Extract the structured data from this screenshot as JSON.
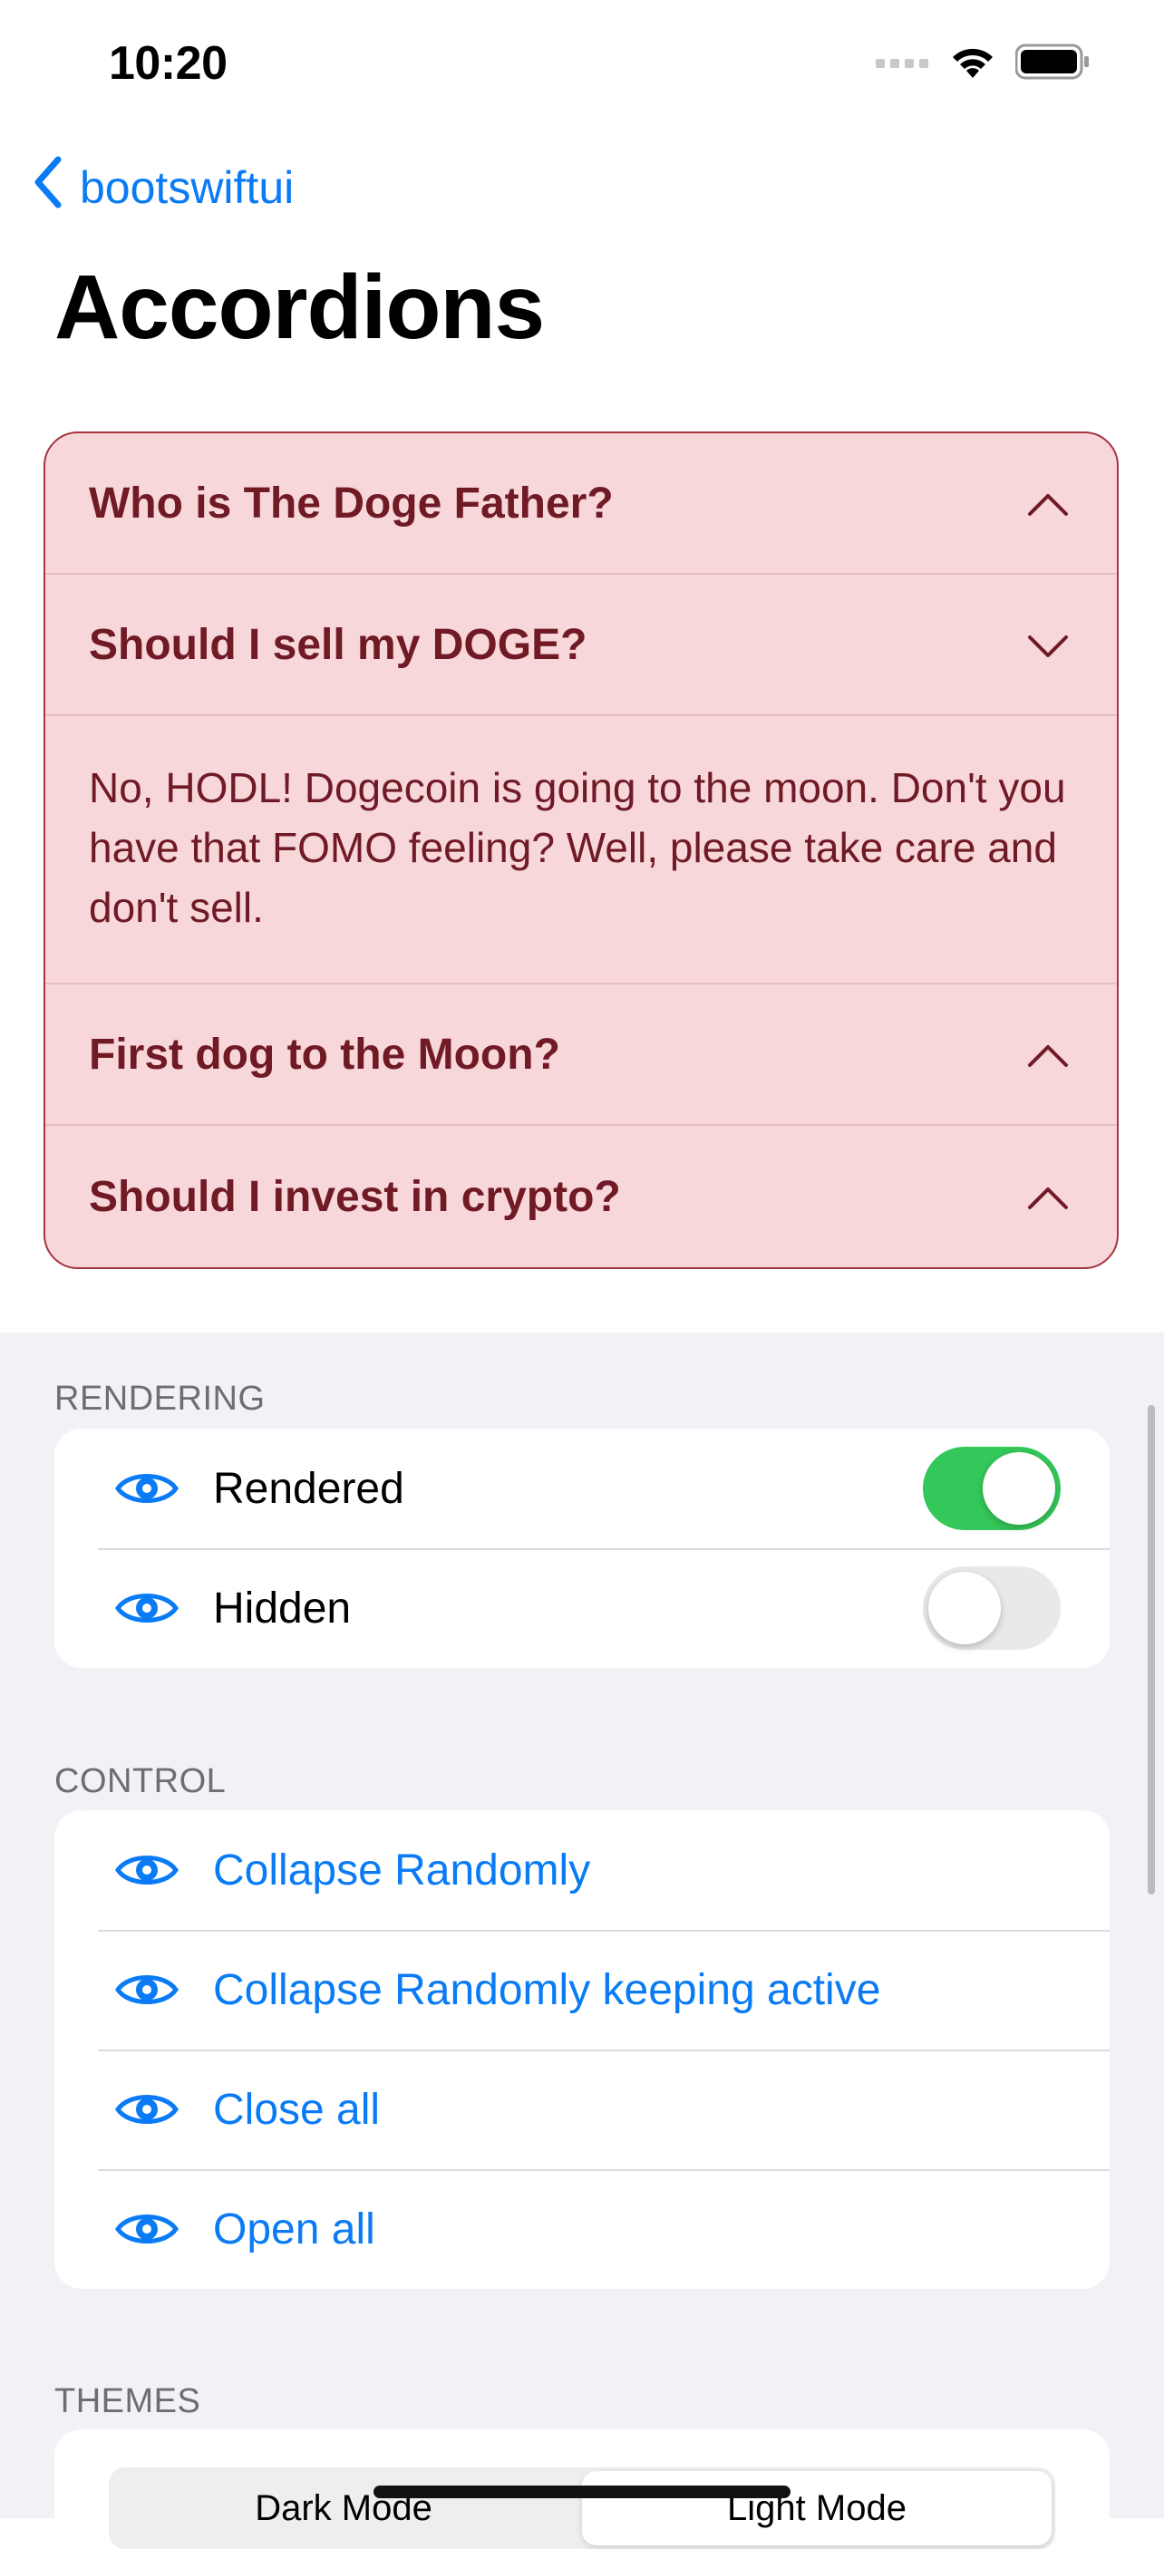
{
  "status_bar": {
    "time": "10:20",
    "icons": [
      "cellular-signal-icon",
      "wifi-icon",
      "battery-icon"
    ]
  },
  "nav": {
    "back_label": "bootswiftui",
    "title": "Accordions"
  },
  "accordion": {
    "colors": {
      "background": "#f8d7da",
      "border": "#a4353f",
      "text": "#6f1a25"
    },
    "items": [
      {
        "title": "Who is The Doge Father?",
        "expanded": false,
        "chevron": "chevron-up-icon"
      },
      {
        "title": "Should I sell my DOGE?",
        "expanded": true,
        "chevron": "chevron-down-icon",
        "body": "No, HODL! Dogecoin is going to the moon. Don't you have that FOMO feeling? Well, please take care and don't sell."
      },
      {
        "title": "First dog to the Moon?",
        "expanded": false,
        "chevron": "chevron-up-icon"
      },
      {
        "title": "Should I invest in crypto?",
        "expanded": false,
        "chevron": "chevron-up-icon"
      }
    ]
  },
  "rendering": {
    "header": "RENDERING",
    "rows": [
      {
        "label": "Rendered",
        "toggle_on": true
      },
      {
        "label": "Hidden",
        "toggle_on": false
      }
    ]
  },
  "control": {
    "header": "CONTROL",
    "rows": [
      {
        "label": "Collapse Randomly"
      },
      {
        "label": "Collapse Randomly keeping active"
      },
      {
        "label": "Close all"
      },
      {
        "label": "Open all"
      }
    ]
  },
  "themes": {
    "header": "THEMES",
    "options": [
      "Dark Mode",
      "Light Mode"
    ],
    "selected": "Light Mode"
  },
  "colors": {
    "accent": "#0a7bf5",
    "toggle_on": "#34c759",
    "grouped_background": "#f2f1f6"
  }
}
